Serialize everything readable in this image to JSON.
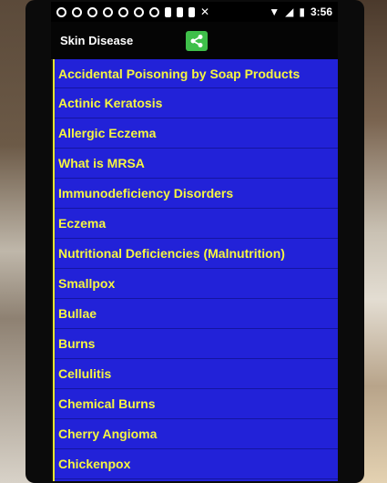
{
  "status_bar": {
    "time": "3:56",
    "icons": [
      "notification-icon",
      "notification-icon",
      "notification-icon",
      "notification-icon",
      "notification-icon",
      "notification-icon",
      "notification-icon",
      "person-icon",
      "person-icon",
      "person-icon",
      "wrench-icon",
      "wifi-icon",
      "signal-icon",
      "battery-icon"
    ]
  },
  "app_bar": {
    "title": "Skin Disease",
    "share_icon": "share-icon",
    "share_color": "#3fbf4a"
  },
  "colors": {
    "list_background": "#2222d8",
    "list_text": "#f6f640",
    "divider": "#1515a0"
  },
  "list": {
    "items": [
      {
        "label": "Accidental Poisoning by Soap Products"
      },
      {
        "label": "Actinic Keratosis"
      },
      {
        "label": "Allergic Eczema"
      },
      {
        "label": "What is MRSA"
      },
      {
        "label": "Immunodeficiency Disorders"
      },
      {
        "label": "Eczema"
      },
      {
        "label": "Nutritional Deficiencies (Malnutrition)"
      },
      {
        "label": "Smallpox"
      },
      {
        "label": "Bullae"
      },
      {
        "label": "Burns"
      },
      {
        "label": "Cellulitis"
      },
      {
        "label": "Chemical Burns"
      },
      {
        "label": "Cherry Angioma"
      },
      {
        "label": "Chickenpox"
      }
    ]
  }
}
